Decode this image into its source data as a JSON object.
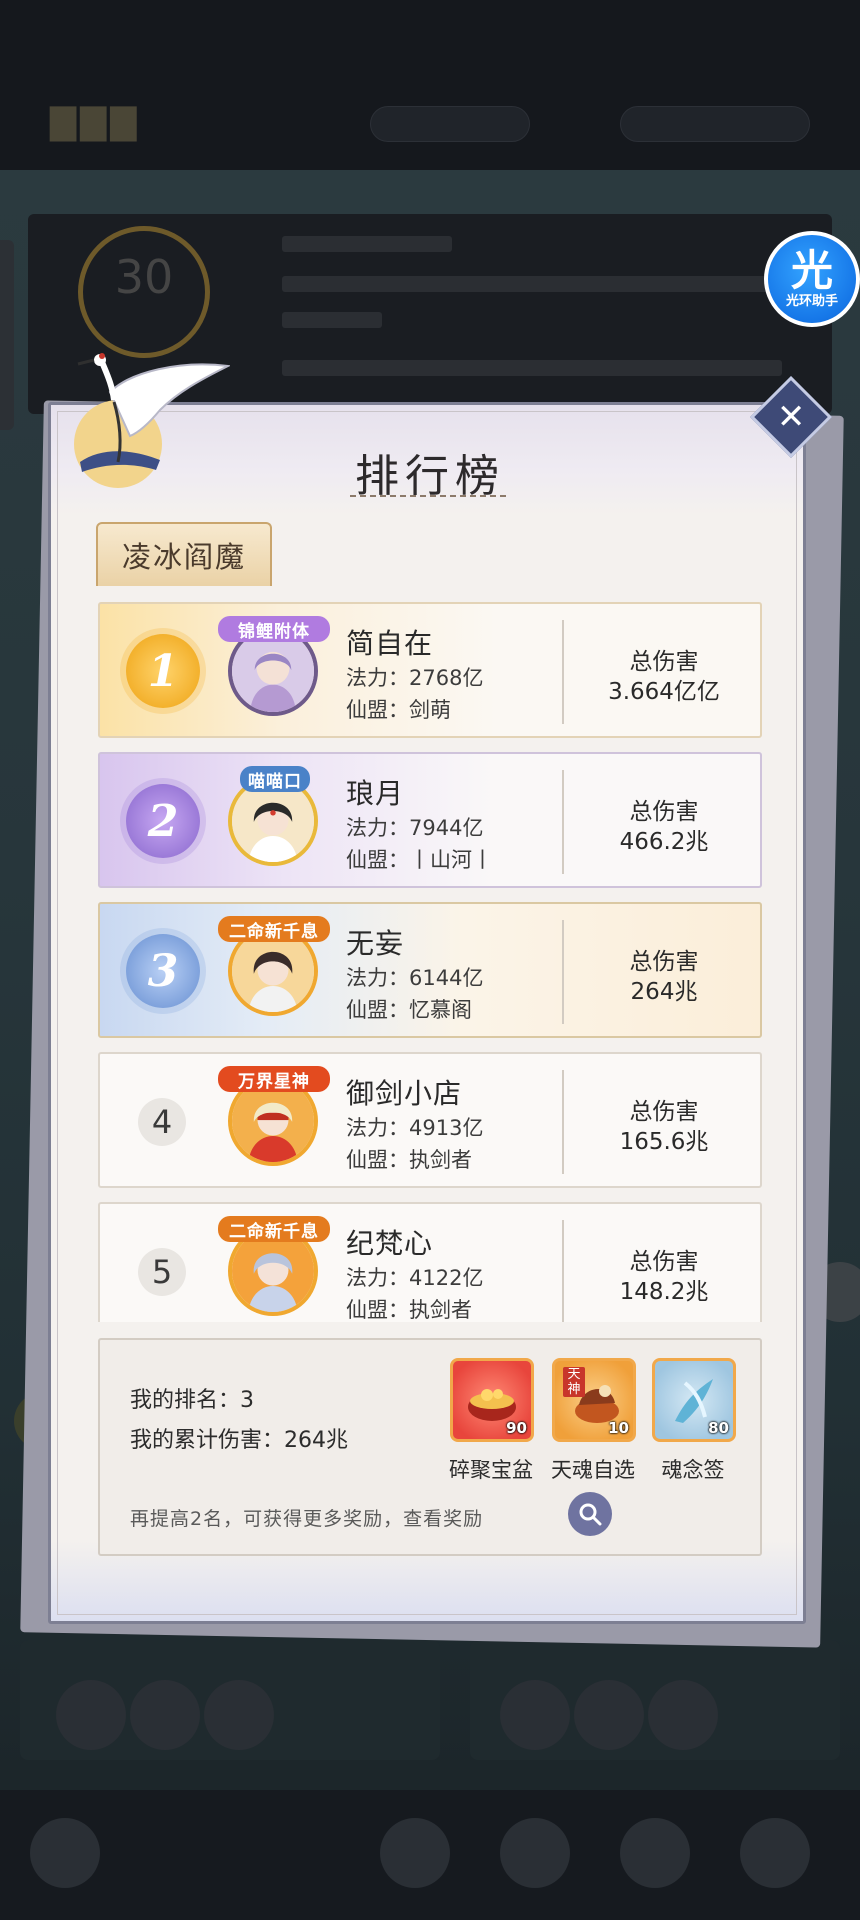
{
  "helper": {
    "glyph": "光",
    "label": "光环助手"
  },
  "background": {
    "ring_number": "30"
  },
  "dialog": {
    "title": "排行榜",
    "boss_tab": "凌冰阎魔",
    "close_icon": "✕"
  },
  "labels": {
    "power_prefix": "法力：",
    "guild_prefix": "仙盟：",
    "damage_label": "总伤害"
  },
  "rankings": [
    {
      "rank": "1",
      "title_badge": "锦鲤附体",
      "name": "简自在",
      "power": "2768亿",
      "guild": "剑萌",
      "damage": "3.664亿亿"
    },
    {
      "rank": "2",
      "title_badge": "喵喵口",
      "name": "琅月",
      "power": "7944亿",
      "guild": "丨山河丨",
      "damage": "466.2兆"
    },
    {
      "rank": "3",
      "title_badge": "二命新千息",
      "name": "无妄",
      "power": "6144亿",
      "guild": "忆慕阁",
      "damage": "264兆"
    },
    {
      "rank": "4",
      "title_badge": "万界星神",
      "name": "御剑小店",
      "power": "4913亿",
      "guild": "执剑者",
      "damage": "165.6兆"
    },
    {
      "rank": "5",
      "title_badge": "二命新千息",
      "name": "纪梵心",
      "power": "4122亿",
      "guild": "执剑者",
      "damage": "148.2兆"
    }
  ],
  "my_status": {
    "rank_text": "我的排名：3",
    "damage_text": "我的累计伤害：264兆",
    "hint": "再提高2名，可获得更多奖励，查看奖励",
    "rewards": [
      {
        "name": "碎聚宝盆",
        "count": "90",
        "icon": "treasure-bowl-icon",
        "color": "#e8453c"
      },
      {
        "name": "天魂自选",
        "count": "10",
        "icon": "soul-select-icon",
        "color": "#f0a03a",
        "tag": "天神"
      },
      {
        "name": "魂念签",
        "count": "80",
        "icon": "soul-tag-icon",
        "color": "#9fc6e0"
      }
    ]
  }
}
